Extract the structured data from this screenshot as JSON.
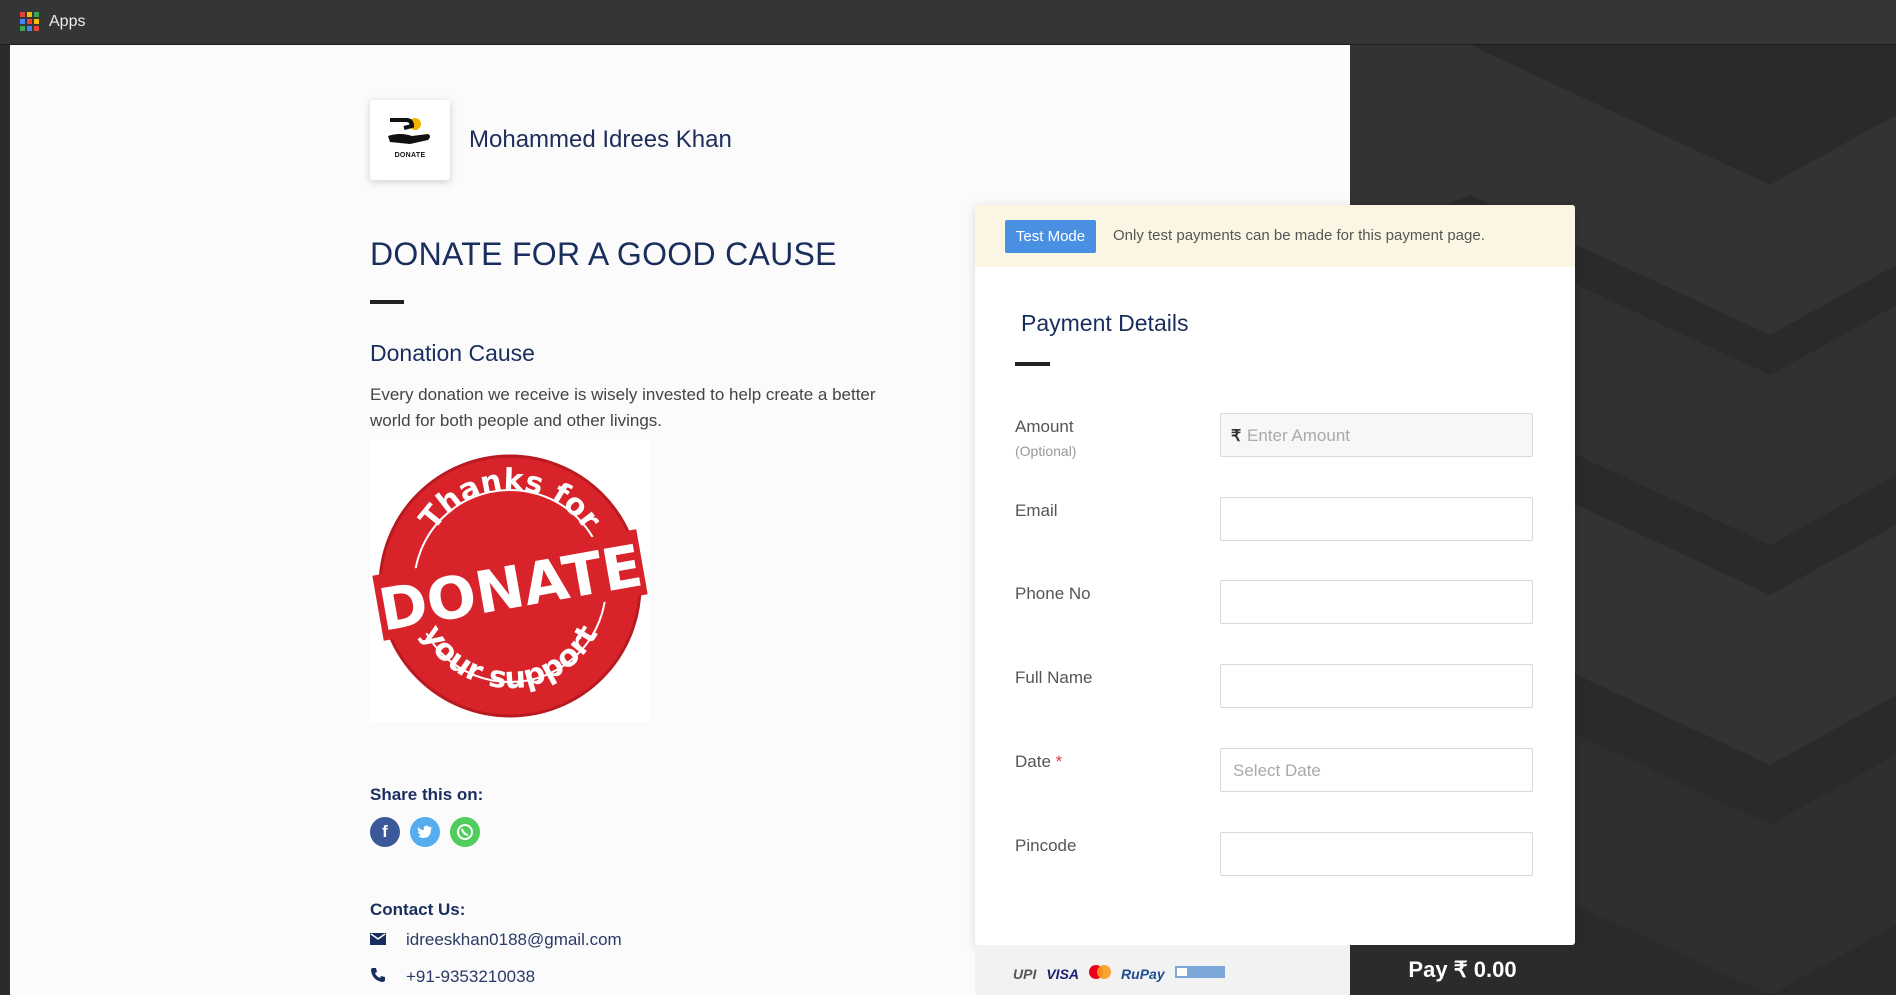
{
  "topbar": {
    "apps_label": "Apps"
  },
  "merchant": {
    "name": "Mohammed Idrees Khan",
    "logo_text": "DONATE"
  },
  "page": {
    "title": "DONATE FOR A GOOD CAUSE",
    "cause_heading": "Donation Cause",
    "cause_text": "Every donation we receive is wisely invested  to help create a better world for both people and other livings.",
    "image_text": {
      "top": "Thanks for",
      "middle": "DONATE",
      "bottom": "your support"
    },
    "share_label": "Share this on:",
    "contact_label": "Contact Us:",
    "email": "idreeskhan0188@gmail.com",
    "phone": "+91-9353210038"
  },
  "test_mode": {
    "badge": "Test Mode",
    "message": "Only test payments can be made for this payment page."
  },
  "payment": {
    "heading": "Payment Details",
    "fields": [
      {
        "label": "Amount",
        "sublabel": "(Optional)",
        "currency": "₹",
        "placeholder": "Enter Amount"
      },
      {
        "label": "Email",
        "placeholder": ""
      },
      {
        "label": "Phone No",
        "placeholder": ""
      },
      {
        "label": "Full Name",
        "placeholder": ""
      },
      {
        "label": "Date",
        "required_mark": "*",
        "placeholder": "Select Date"
      },
      {
        "label": "Pincode",
        "placeholder": ""
      }
    ],
    "methods": [
      "UPI",
      "VISA",
      "RuPay"
    ],
    "pay_button": "Pay  ₹ 0.00"
  },
  "colors": {
    "accent": "#4a90e2",
    "title": "#1a2e5e",
    "stamp": "#d8232a"
  }
}
